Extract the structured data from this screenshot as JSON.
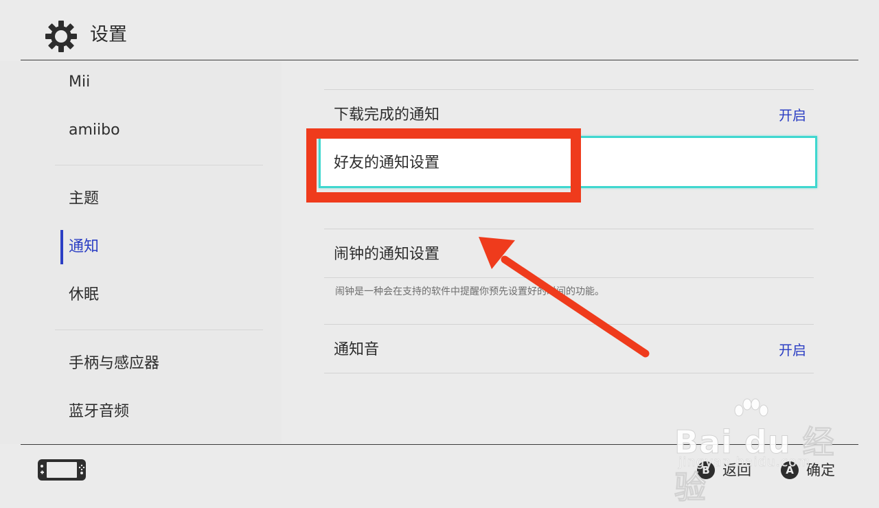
{
  "header": {
    "title": "设置",
    "icon": "gear-icon"
  },
  "sidebar": {
    "items": [
      {
        "label": "Mii"
      },
      {
        "label": "amiibo"
      },
      {
        "label": "主题"
      },
      {
        "label": "通知",
        "active": true
      },
      {
        "label": "休眠"
      },
      {
        "label": "手柄与感应器"
      },
      {
        "label": "蓝牙音频"
      }
    ]
  },
  "main": {
    "rows": [
      {
        "label": "下载完成的通知",
        "value": "开启"
      },
      {
        "label": "好友的通知设置",
        "focused": true
      },
      {
        "label": "闹钟的通知设置",
        "description": "闹钟是一种会在支持的软件中提醒你预先设置好的时间的功能。"
      },
      {
        "label": "通知音",
        "value": "开启"
      }
    ]
  },
  "footer": {
    "back": {
      "button": "B",
      "label": "返回"
    },
    "confirm": {
      "button": "A",
      "label": "确定"
    }
  },
  "watermark": {
    "brand": "Bai du 经验",
    "url": "jingyan.baidu.com"
  },
  "colors": {
    "accent": "#2c3fc4",
    "focus_border": "#3fd7cf",
    "annotation": "#ef3b1c",
    "background": "#ebebeb"
  }
}
